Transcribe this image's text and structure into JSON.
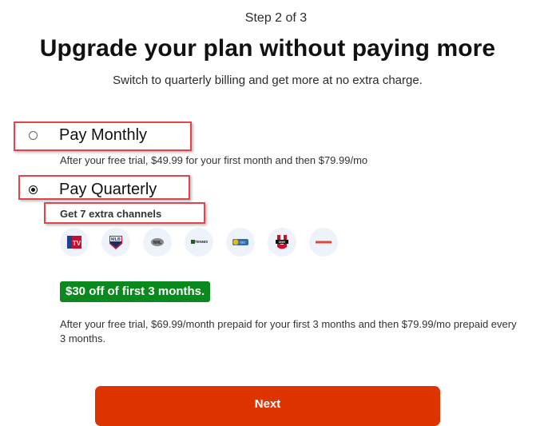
{
  "header": {
    "step": "Step 2 of 3",
    "title": "Upgrade your plan without paying more",
    "subtitle": "Switch to quarterly billing and get more at no extra charge."
  },
  "plans": {
    "monthly": {
      "label": "Pay Monthly",
      "selected": false,
      "description": "After your free trial, $49.99 for your first month and then $79.99/mo"
    },
    "quarterly": {
      "label": "Pay Quarterly",
      "selected": true,
      "extra_channels": "Get 7 extra channels",
      "channels": [
        {
          "name": "NBA TV",
          "icon": "nba-tv-logo"
        },
        {
          "name": "MLB Network",
          "icon": "mlb-network-logo"
        },
        {
          "name": "NHL Network",
          "icon": "nhl-network-logo"
        },
        {
          "name": "Tennis Channel",
          "icon": "tennis-channel-logo"
        },
        {
          "name": "SEC Network",
          "icon": "sec-network-logo"
        },
        {
          "name": "Big Ten / Stadium U",
          "icon": "u-network-logo"
        },
        {
          "name": "Sportsman",
          "icon": "sportsman-logo"
        }
      ],
      "promo": "$30 off of first 3 months.",
      "description": "After your free trial, $69.99/month prepaid for your first 3 months and then $79.99/mo prepaid every 3 months."
    }
  },
  "actions": {
    "next_label": "Next"
  },
  "colors": {
    "primary_button": "#de3400",
    "promo_badge": "#0a8a1e",
    "highlight_box": "#e5424a",
    "logo_bg": "#eef3fb"
  }
}
